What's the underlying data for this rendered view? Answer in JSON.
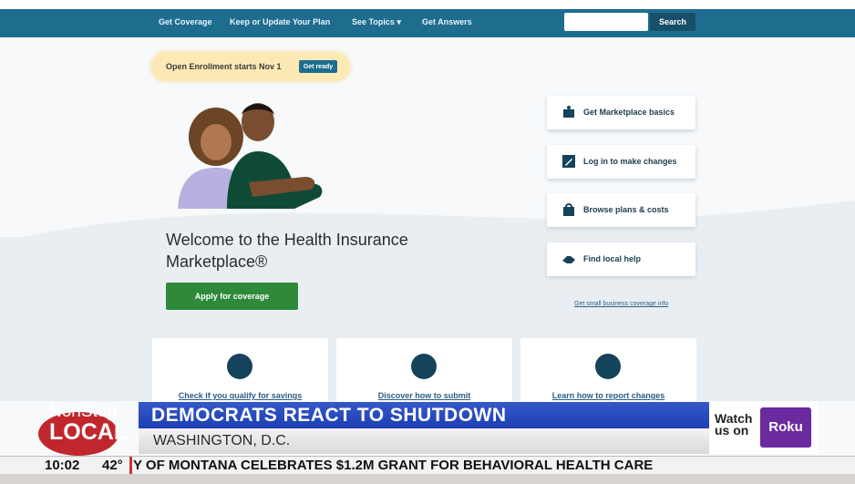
{
  "nav": {
    "items": [
      "Get Coverage",
      "Keep or Update Your Plan",
      "See Topics",
      "Get Answers"
    ],
    "see_topics_caret": "▾",
    "search_button": "Search"
  },
  "banner": {
    "text": "Open Enrollment starts Nov 1",
    "button": "Get ready"
  },
  "hero": {
    "welcome_line1": "Welcome to the Health Insurance",
    "welcome_line2": "Marketplace®",
    "apply_button": "Apply for coverage"
  },
  "side_links": [
    {
      "label": "Get Marketplace basics",
      "icon": "book-icon"
    },
    {
      "label": "Log in to make changes",
      "icon": "pencil-icon"
    },
    {
      "label": "Browse plans & costs",
      "icon": "bag-icon"
    },
    {
      "label": "Find local help",
      "icon": "handshake-icon"
    }
  ],
  "small_business_link": "Get small business coverage info",
  "bottom_cards": [
    {
      "label": "Check if you qualify for savings",
      "icon": "money-icon"
    },
    {
      "label": "Discover how to submit",
      "icon": "document-icon"
    },
    {
      "label": "Learn how to report changes",
      "icon": "clipboard-icon"
    }
  ],
  "broadcast": {
    "logo_line1": "NonStop",
    "logo_line2": "LOCAL",
    "headline": "DEMOCRATS REACT TO SHUTDOWN",
    "location": "WASHINGTON, D.C.",
    "watch_text_1": "Watch",
    "watch_text_2": "us on",
    "roku": "Roku",
    "time": "10:02",
    "temp": "42°",
    "crawl": "Y OF MONTANA CELEBRATES $1.2M GRANT FOR BEHAVIORAL HEALTH CARE"
  },
  "colors": {
    "nav": "#1e6d8f",
    "apply": "#2e8a3a",
    "headline_bar": "#2a4fc3",
    "roku": "#6b2aa0"
  }
}
